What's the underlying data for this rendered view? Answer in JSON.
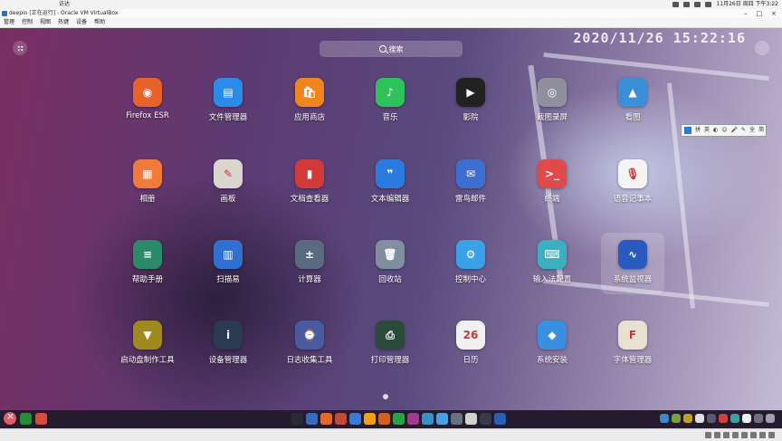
{
  "host_bar": {
    "app_name": "访达",
    "datetime": "11月26日 周四 下午3:22"
  },
  "vm_window": {
    "title": "deepin [正在运行] - Oracle VM VirtualBox",
    "menu": [
      "管理",
      "控制",
      "视图",
      "热键",
      "设备",
      "帮助"
    ]
  },
  "watermark": "2020/11/26  15:22:16",
  "launcher": {
    "search_placeholder": "搜索",
    "apps": [
      {
        "label": "Firefox ESR",
        "icon": "firefox-icon",
        "color": "#e8632b",
        "glyph": "◉"
      },
      {
        "label": "文件管理器",
        "icon": "file-manager-icon",
        "color": "#2a8be8",
        "glyph": "▤"
      },
      {
        "label": "应用商店",
        "icon": "app-store-icon",
        "color": "#f0841e",
        "glyph": "🛍"
      },
      {
        "label": "音乐",
        "icon": "music-icon",
        "color": "#2ec25a",
        "glyph": "♪"
      },
      {
        "label": "影院",
        "icon": "movie-icon",
        "color": "#222222",
        "glyph": "▶"
      },
      {
        "label": "截图录屏",
        "icon": "screenshot-icon",
        "color": "#8f8fa0",
        "glyph": "◎"
      },
      {
        "label": "看图",
        "icon": "image-viewer-icon",
        "color": "#3a8fd8",
        "glyph": "▲"
      },
      {
        "label": "相册",
        "icon": "album-icon",
        "color": "#f07a3a",
        "glyph": "▦"
      },
      {
        "label": "画板",
        "icon": "drawing-icon",
        "color": "#d9d6cf",
        "glyph": "✎"
      },
      {
        "label": "文档查看器",
        "icon": "document-viewer-icon",
        "color": "#d23a3a",
        "glyph": "▮"
      },
      {
        "label": "文本编辑器",
        "icon": "text-editor-icon",
        "color": "#2a7ae0",
        "glyph": "❞"
      },
      {
        "label": "雷鸟邮件",
        "icon": "thunderbird-icon",
        "color": "#3c6fd0",
        "glyph": "✉"
      },
      {
        "label": "终端",
        "icon": "terminal-icon",
        "color": "#e04a4a",
        "glyph": ">_"
      },
      {
        "label": "语音记事本",
        "icon": "voice-notes-icon",
        "color": "#f4f4f4",
        "glyph": "🎙"
      },
      {
        "label": "帮助手册",
        "icon": "help-manual-icon",
        "color": "#2a8a6a",
        "glyph": "≡"
      },
      {
        "label": "扫描易",
        "icon": "scanner-icon",
        "color": "#3070d0",
        "glyph": "▥"
      },
      {
        "label": "计算器",
        "icon": "calculator-icon",
        "color": "#5a6a80",
        "glyph": "±"
      },
      {
        "label": "回收站",
        "icon": "trash-icon",
        "color": "#7f8fa0",
        "glyph": "🗑"
      },
      {
        "label": "控制中心",
        "icon": "control-center-icon",
        "color": "#3aa0e8",
        "glyph": "⚙"
      },
      {
        "label": "输入法配置",
        "icon": "input-method-icon",
        "color": "#3ab0c0",
        "glyph": "⌨"
      },
      {
        "label": "系统监视器",
        "icon": "system-monitor-icon",
        "color": "#2a5ac0",
        "glyph": "∿"
      },
      {
        "label": "启动盘制作工具",
        "icon": "boot-maker-icon",
        "color": "#a08a20",
        "glyph": "▼"
      },
      {
        "label": "设备管理器",
        "icon": "device-manager-icon",
        "color": "#2a3a50",
        "glyph": "i"
      },
      {
        "label": "日志收集工具",
        "icon": "log-collector-icon",
        "color": "#4a5aa0",
        "glyph": "⌚"
      },
      {
        "label": "打印管理器",
        "icon": "print-manager-icon",
        "color": "#2a4a3a",
        "glyph": "⎙"
      },
      {
        "label": "日历",
        "icon": "calendar-icon",
        "color": "#f0f0f0",
        "glyph": "26"
      },
      {
        "label": "系统安装",
        "icon": "installer-icon",
        "color": "#3a90e0",
        "glyph": "◆"
      },
      {
        "label": "字体管理器",
        "icon": "font-manager-icon",
        "color": "#e8e0d0",
        "glyph": "F"
      }
    ]
  },
  "ime_toolbar": [
    "拼",
    "英",
    "◐",
    "☺",
    "🎤",
    "✎",
    "全",
    "简"
  ],
  "dock": {
    "left_items": [
      {
        "icon": "launcher-icon",
        "color": "#e35b6a"
      },
      {
        "icon": "terminal-dock-icon",
        "color": "#2a8a3a"
      },
      {
        "icon": "app-dock-icon",
        "color": "#d84a3a"
      }
    ],
    "center_items": [
      "#2a2a35",
      "#3a6ac0",
      "#e06a2a",
      "#c04a3a",
      "#3a7ad0",
      "#f0a020",
      "#d06020",
      "#2aa04a",
      "#a03a8a",
      "#3a90c0",
      "#4aa0e0",
      "#6a7080",
      "#d0d0d0",
      "#3a3a4a",
      "#2a60b0"
    ],
    "right_items": [
      "#3a8ad0",
      "#7aa040",
      "#c0a020",
      "#e0e0e0",
      "#5a5a70",
      "#d04040",
      "#3aa0a0",
      "#f0f0f0",
      "#707080",
      "#a0a0b0"
    ]
  }
}
